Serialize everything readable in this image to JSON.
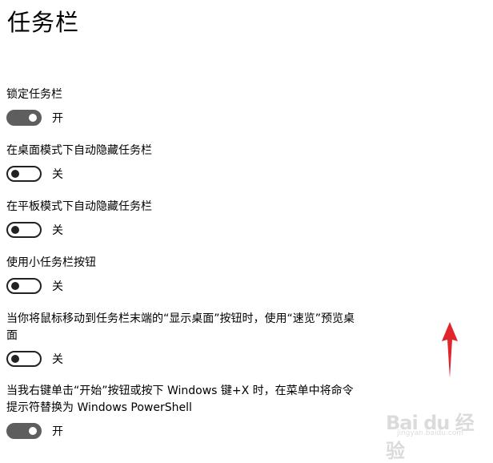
{
  "page": {
    "title": "任务栏"
  },
  "settings": [
    {
      "label": "锁定任务栏",
      "state": "开",
      "on": true
    },
    {
      "label": "在桌面模式下自动隐藏任务栏",
      "state": "关",
      "on": false
    },
    {
      "label": "在平板模式下自动隐藏任务栏",
      "state": "关",
      "on": false
    },
    {
      "label": "使用小任务栏按钮",
      "state": "关",
      "on": false
    },
    {
      "label": "当你将鼠标移动到任务栏末端的“显示桌面”按钮时，使用“速览”预览桌面",
      "state": "关",
      "on": false
    },
    {
      "label": "当我右键单击“开始”按钮或按下 Windows 键+X 时，在菜单中将命令提示符替换为 Windows PowerShell",
      "state": "开",
      "on": true
    }
  ],
  "annotation": {
    "arrow_color": "#e0262b",
    "arrow_icon": "red-arrow-up-icon"
  },
  "watermark": {
    "main": "Bai du 经验",
    "sub": "jingyan.baidu.com"
  }
}
